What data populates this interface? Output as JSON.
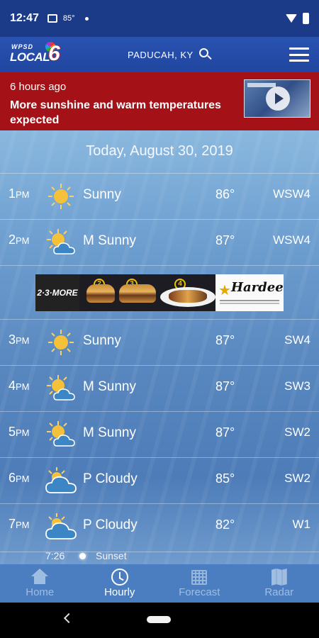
{
  "status_bar": {
    "time": "12:47",
    "temperature": "85°"
  },
  "header": {
    "logo_top": "WPSD",
    "logo_main": "LOCAL",
    "logo_number": "6",
    "location": "PADUCAH, KY"
  },
  "news": {
    "time_ago": "6 hours ago",
    "headline": "More sunshine and warm temperatures expected"
  },
  "main": {
    "date": "Today, August 30, 2019"
  },
  "hours": [
    {
      "hour": "1",
      "suffix": "PM",
      "condition": "Sunny",
      "icon": "sun-icon",
      "temp": "86°",
      "wind": "WSW4"
    },
    {
      "hour": "2",
      "suffix": "PM",
      "condition": "M Sunny",
      "icon": "mostly-sunny-icon",
      "temp": "87°",
      "wind": "WSW4"
    },
    {
      "hour": "3",
      "suffix": "PM",
      "condition": "Sunny",
      "icon": "sun-icon",
      "temp": "87°",
      "wind": "SW4"
    },
    {
      "hour": "4",
      "suffix": "PM",
      "condition": "M Sunny",
      "icon": "mostly-sunny-icon",
      "temp": "87°",
      "wind": "SW3"
    },
    {
      "hour": "5",
      "suffix": "PM",
      "condition": "M Sunny",
      "icon": "mostly-sunny-icon",
      "temp": "87°",
      "wind": "SW2"
    },
    {
      "hour": "6",
      "suffix": "PM",
      "condition": "P Cloudy",
      "icon": "partly-cloudy-icon",
      "temp": "85°",
      "wind": "SW2"
    },
    {
      "hour": "7",
      "suffix": "PM",
      "condition": "P Cloudy",
      "icon": "partly-cloudy-icon",
      "temp": "82°",
      "wind": "W1"
    }
  ],
  "ad": {
    "left_text": "2·3·MORE",
    "brand": "Hardee's",
    "numbers": [
      "2",
      "3",
      "4"
    ]
  },
  "sunset": {
    "time": "7:26",
    "label": "Sunset"
  },
  "bottom_nav": [
    {
      "label": "Home",
      "icon": "home-icon",
      "active": false
    },
    {
      "label": "Hourly",
      "icon": "clock-icon",
      "active": true
    },
    {
      "label": "Forecast",
      "icon": "calendar-icon",
      "active": false
    },
    {
      "label": "Radar",
      "icon": "map-icon",
      "active": false
    }
  ],
  "colors": {
    "status_bar": "#1b3a87",
    "header": "#2a52b0",
    "news_banner": "#a41218",
    "nav_bar": "#4a7ec0",
    "sun": "#f6c13a",
    "cloud": "#3d86c6"
  }
}
